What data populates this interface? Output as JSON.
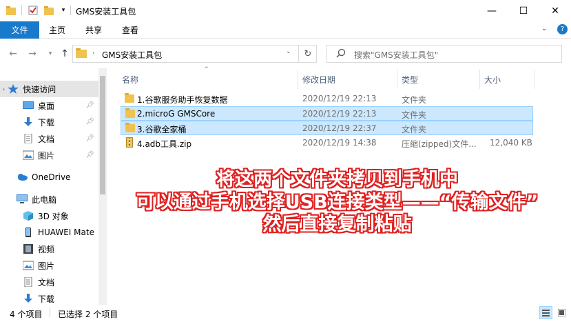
{
  "window": {
    "title": "GMS安装工具包"
  },
  "ribbon": {
    "tabs": [
      "文件",
      "主页",
      "共享",
      "查看"
    ]
  },
  "address": {
    "path": "GMS安装工具包",
    "search_placeholder": "搜索\"GMS安装工具包\""
  },
  "sidebar": {
    "items": [
      {
        "label": "快速访问",
        "icon": "star-icon"
      },
      {
        "label": "桌面",
        "icon": "desktop-icon",
        "pinned": true
      },
      {
        "label": "下载",
        "icon": "download-icon",
        "pinned": true
      },
      {
        "label": "文档",
        "icon": "document-icon",
        "pinned": true
      },
      {
        "label": "图片",
        "icon": "picture-icon",
        "pinned": true
      },
      {
        "label": "OneDrive",
        "icon": "cloud-icon"
      },
      {
        "label": "此电脑",
        "icon": "pc-icon"
      },
      {
        "label": "3D 对象",
        "icon": "cube-icon"
      },
      {
        "label": "HUAWEI Mate",
        "icon": "phone-icon"
      },
      {
        "label": "视频",
        "icon": "video-icon"
      },
      {
        "label": "图片",
        "icon": "picture-icon"
      },
      {
        "label": "文档",
        "icon": "document-icon"
      },
      {
        "label": "下载",
        "icon": "download-icon"
      }
    ]
  },
  "columns": {
    "name": "名称",
    "date": "修改日期",
    "type": "类型",
    "size": "大小"
  },
  "files": [
    {
      "name": "1.谷歌服务助手恢复数据",
      "date": "2020/12/19 22:13",
      "type": "文件夹",
      "size": "",
      "selected": false
    },
    {
      "name": "2.microG GMSCore",
      "date": "2020/12/19 22:13",
      "type": "文件夹",
      "size": "",
      "selected": true
    },
    {
      "name": "3.谷歌全家桶",
      "date": "2020/12/19 22:37",
      "type": "文件夹",
      "size": "",
      "selected": true
    },
    {
      "name": "4.adb工具.zip",
      "date": "2020/12/19 14:38",
      "type": "压缩(zipped)文件...",
      "size": "12,040 KB",
      "selected": false
    }
  ],
  "overlay": {
    "line1": "将这两个文件夹拷贝到手机中",
    "line2": "可以通过手机选择USB连接类型——“传输文件”",
    "line3": "然后直接复制粘贴"
  },
  "status": {
    "count": "4 个项目",
    "selected": "已选择 2 个项目"
  },
  "colors": {
    "accent": "#1979ca",
    "selection": "#cce8ff",
    "overlay_stroke": "#e02020"
  }
}
